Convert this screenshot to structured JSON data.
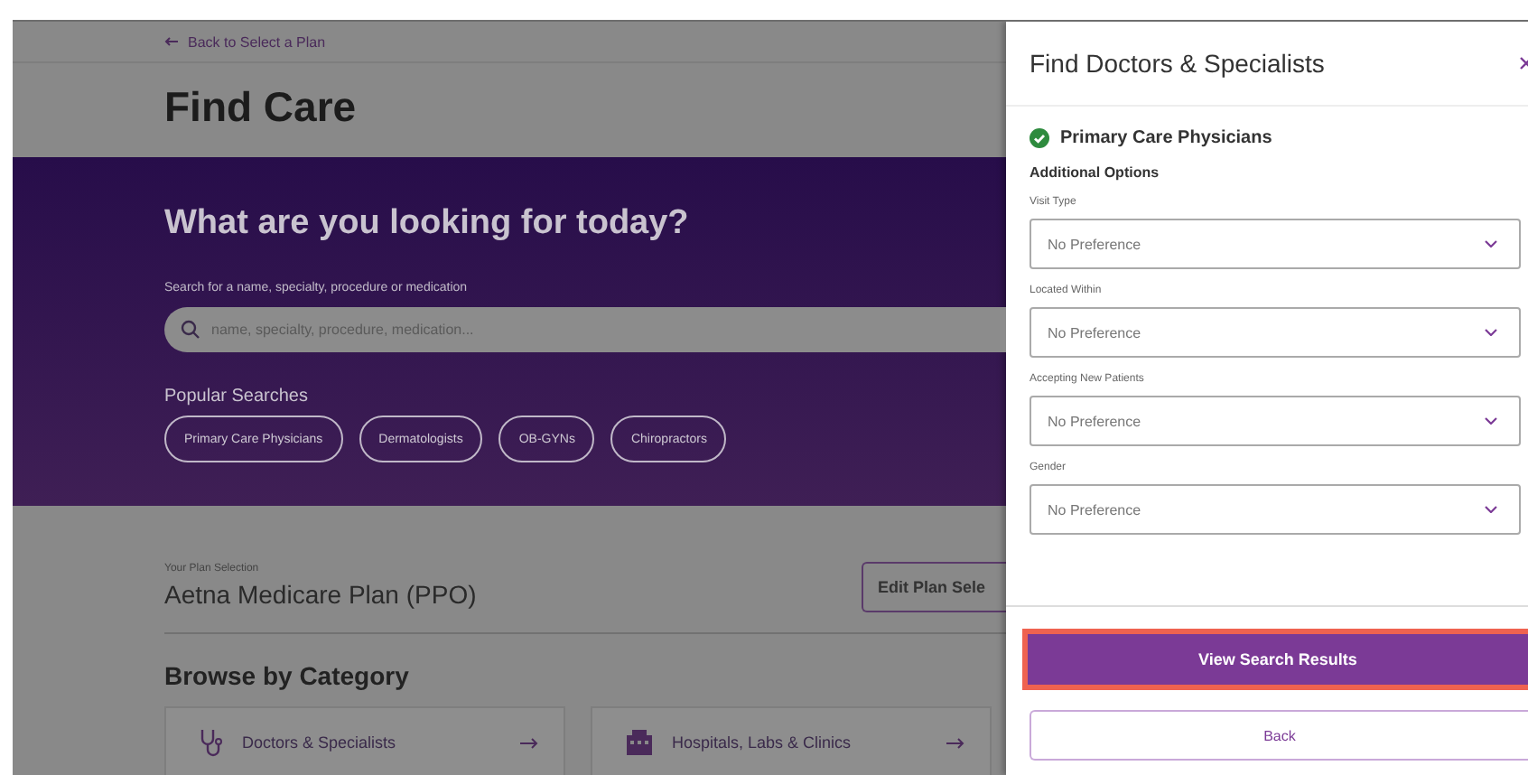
{
  "back_link": "Back to Select a Plan",
  "page_title": "Find Care",
  "hero": {
    "heading": "What are you looking for today?",
    "search_label": "Search for a name, specialty, procedure or medication",
    "search_placeholder": "name, specialty, procedure, medication...",
    "popular_label": "Popular Searches",
    "popular_searches": [
      "Primary Care Physicians",
      "Dermatologists",
      "OB-GYNs",
      "Chiropractors"
    ]
  },
  "plan": {
    "label": "Your Plan Selection",
    "name": "Aetna Medicare Plan (PPO)",
    "edit_button": "Edit Plan Sele"
  },
  "browse": {
    "title": "Browse by Category",
    "categories": [
      {
        "kind": "doctors",
        "label": "Doctors & Specialists"
      },
      {
        "kind": "hospitals",
        "label": "Hospitals, Labs & Clinics"
      }
    ]
  },
  "drawer": {
    "title": "Find Doctors & Specialists",
    "selected_specialty": "Primary Care Physicians",
    "section_title": "Additional Options",
    "filters": [
      {
        "label": "Visit Type",
        "value": "No Preference"
      },
      {
        "label": "Located Within",
        "value": "No Preference"
      },
      {
        "label": "Accepting New Patients",
        "value": "No Preference"
      },
      {
        "label": "Gender",
        "value": "No Preference"
      }
    ],
    "primary_button": "View Search Results",
    "secondary_button": "Back"
  }
}
